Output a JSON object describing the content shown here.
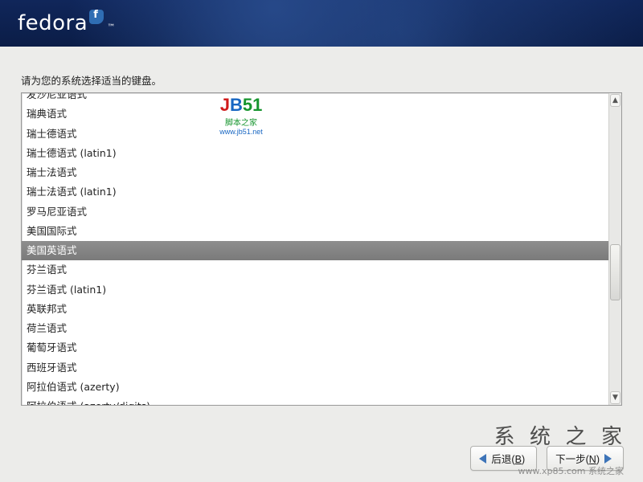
{
  "brand": {
    "name": "fedora",
    "tm": "™"
  },
  "prompt": "请为您的系统选择适当的键盘。",
  "keyboard_list": {
    "selected_index": 8,
    "items": [
      "发沙尼亚语式",
      "瑞典语式",
      "瑞士德语式",
      "瑞士德语式 (latin1)",
      "瑞士法语式",
      "瑞士法语式 (latin1)",
      "罗马尼亚语式",
      "美国国际式",
      "美国英语式",
      "芬兰语式",
      "芬兰语式 (latin1)",
      "英联邦式",
      "荷兰语式",
      "葡萄牙语式",
      "西班牙语式",
      "阿拉伯语式 (azerty)",
      "阿拉伯语式 (azerty/digits)"
    ]
  },
  "buttons": {
    "back": {
      "label": "后退",
      "mnemonic": "B"
    },
    "next": {
      "label": "下一步",
      "mnemonic": "N"
    }
  },
  "watermarks": {
    "jb51_line1": "JB51",
    "jb51_line2": "脚本之家",
    "jb51_line3": "www.jb51.net",
    "xtzj": "系 统 之 家",
    "url": "www.xp85.com 系统之家"
  }
}
